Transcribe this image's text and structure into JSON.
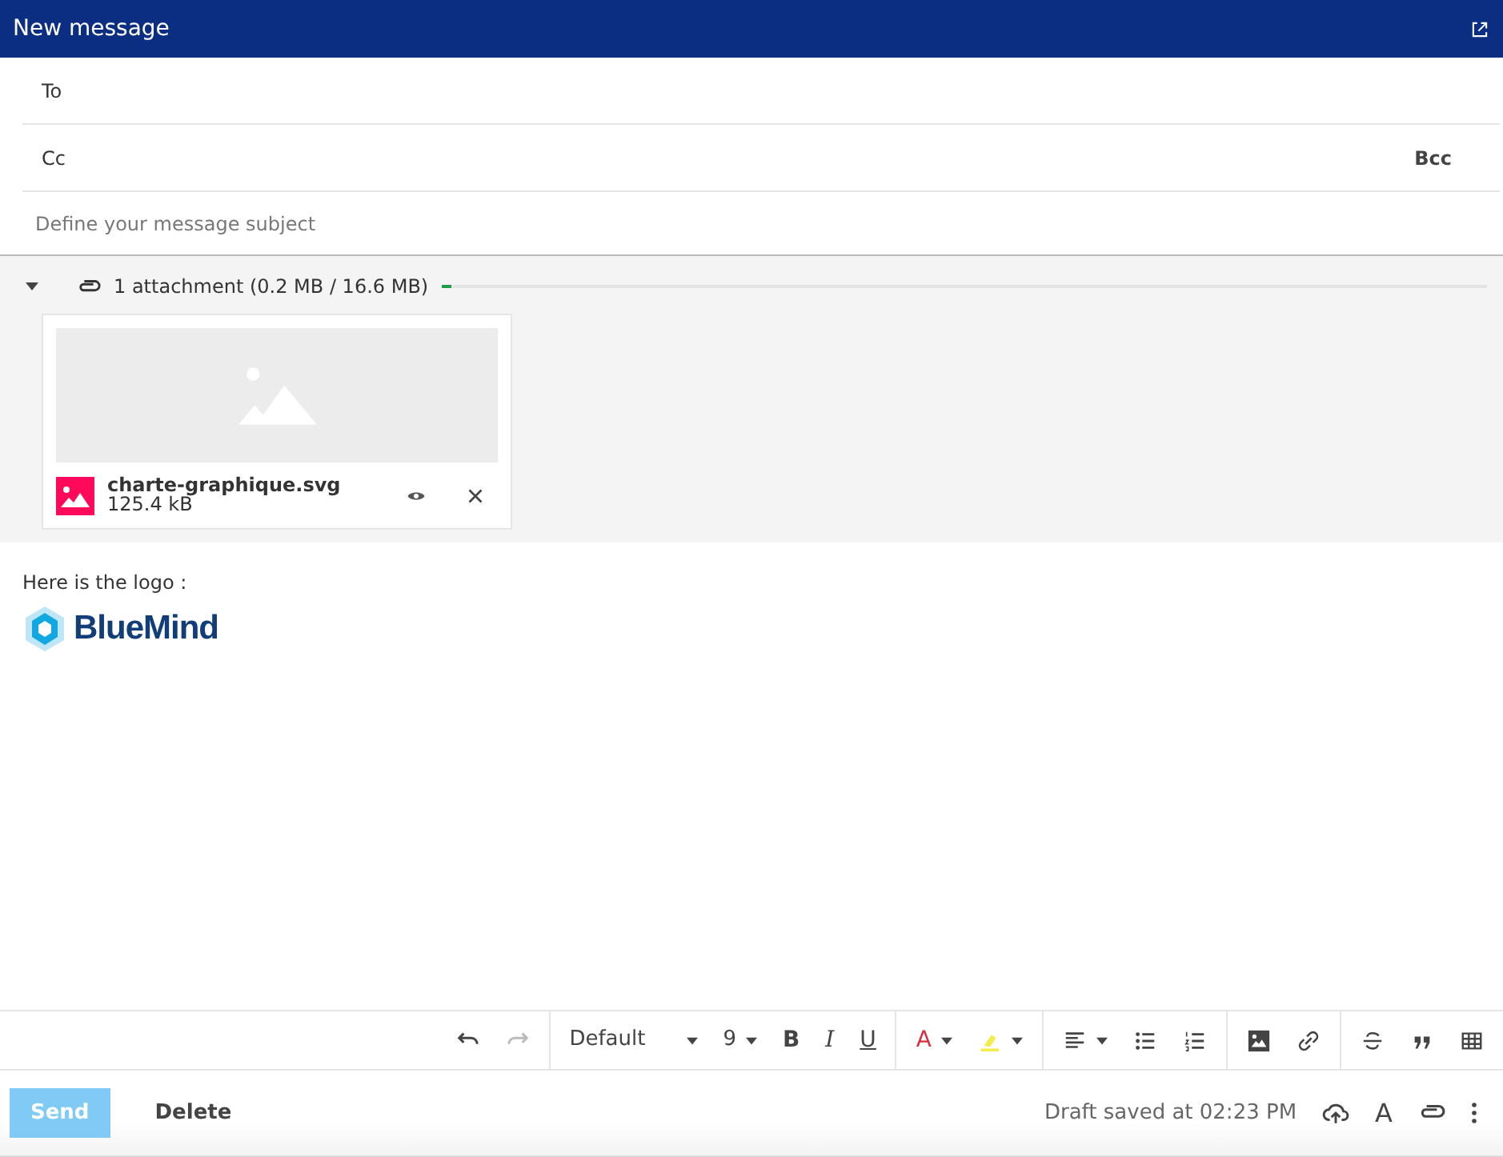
{
  "window": {
    "title": "New message"
  },
  "recipients": [
    {
      "label": "To"
    },
    {
      "label": "Cc",
      "link": "Bcc"
    }
  ],
  "subject": {
    "placeholder": "Define your message subject"
  },
  "attachments": {
    "expanded": true,
    "summary": "1 attachment (0.2 MB / 16.6 MB)",
    "level": 0.01,
    "files": [
      {
        "kind": "picture",
        "name": "charte-graphique.svg",
        "size": "125.4 kB"
      }
    ]
  },
  "body": {
    "text": "Here is the logo :",
    "logo": "BlueMind"
  },
  "toolbar": [
    [
      {
        "kind": "undo",
        "disabled": false
      },
      {
        "kind": "redo",
        "disabled": true
      }
    ],
    [
      {
        "kind": "font",
        "value": "Default",
        "disabled": false
      },
      {
        "kind": "size",
        "value": "9",
        "disabled": false
      },
      {
        "kind": "bold",
        "label": "B",
        "disabled": false
      },
      {
        "kind": "italic",
        "label": "I",
        "disabled": false
      },
      {
        "kind": "underline",
        "label": "U",
        "disabled": false
      }
    ],
    [
      {
        "kind": "text-color",
        "label": "A",
        "color": "#d9303f",
        "disabled": false
      },
      {
        "kind": "highlight",
        "color": "#f2ec4c",
        "disabled": false
      }
    ],
    [
      {
        "kind": "align",
        "disabled": false
      },
      {
        "kind": "bullet-list",
        "disabled": false
      },
      {
        "kind": "numbered-list",
        "disabled": false
      }
    ],
    [
      {
        "kind": "image",
        "disabled": false
      },
      {
        "kind": "link",
        "disabled": false
      }
    ],
    [
      {
        "kind": "strikethrough",
        "disabled": false
      },
      {
        "kind": "quote",
        "disabled": false
      },
      {
        "kind": "table",
        "disabled": false
      }
    ]
  ],
  "footer": {
    "send": {
      "label": "Send",
      "disabled": true
    },
    "delete": {
      "label": "Delete"
    },
    "status": "Draft saved at 02:23 PM",
    "actions": [
      {
        "kind": "cloud-upload"
      },
      {
        "kind": "text-format",
        "label": "A"
      },
      {
        "kind": "attach"
      },
      {
        "kind": "more"
      }
    ]
  }
}
